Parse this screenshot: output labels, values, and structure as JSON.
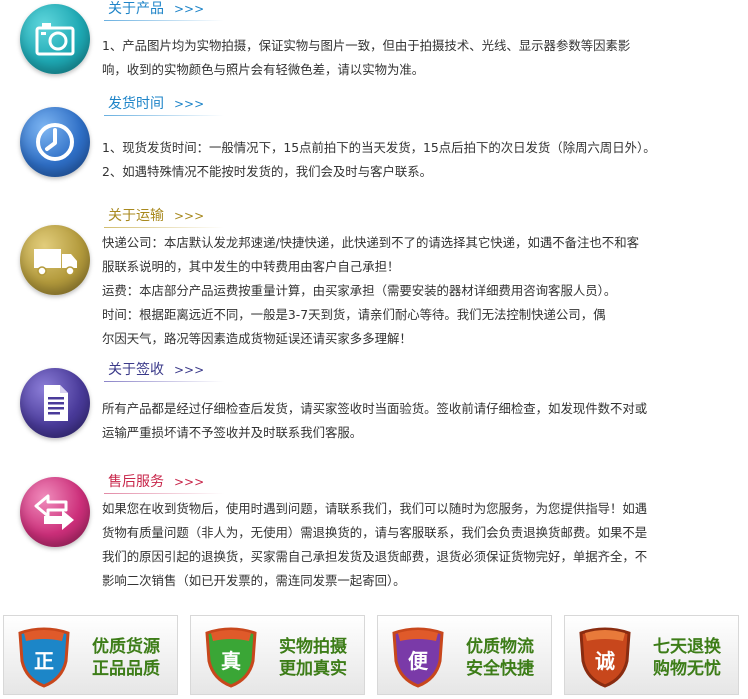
{
  "sections": [
    {
      "title": "关于产品",
      "arrows": ">>>",
      "icon": "camera-icon",
      "color": "#1eaab4",
      "lines": [
        "1、产品图片均为实物拍摄，保证实物与图片一致，但由于拍摄技术、光线、显示器参数等因素影",
        "响，收到的实物颜色与照片会有轻微色差，请以实物为准。"
      ]
    },
    {
      "title": "发货时间",
      "arrows": ">>>",
      "icon": "clock-icon",
      "color": "#2f6fc6",
      "lines": [
        "1、现货发货时间：一般情况下，15点前拍下的当天发货，15点后拍下的次日发货（除周六周日外）。",
        "2、如遇特殊情况不能按时发货的，我们会及时与客户联系。"
      ]
    },
    {
      "title": "关于运输",
      "arrows": ">>>",
      "icon": "truck-icon",
      "color": "#b39a3c",
      "lines": [
        "快递公司：本店默认发龙邦速递/快捷快递，此快递到不了的请选择其它快递，如遇不备注也不和客",
        "服联系说明的，其中发生的中转费用由客户自己承担！",
        "运费：本店部分产品运费按重量计算，由买家承担（需要安装的器材详细费用咨询客服人员）。",
        "时间：根据距离远近不同，一般是3-7天到货，请亲们耐心等待。我们无法控制快递公司，偶",
        "尔因天气，路况等因素造成货物延误还请买家多多理解！"
      ]
    },
    {
      "title": "关于签收",
      "arrows": ">>>",
      "icon": "document-icon",
      "color": "#4a3b9a",
      "lines": [
        "所有产品都是经过仔细检查后发货，请买家签收时当面验货。签收前请仔细检查，如发现件数不对或",
        "运输严重损坏请不予签收并及时联系我们客服。"
      ]
    },
    {
      "title": "售后服务",
      "arrows": ">>>",
      "icon": "exchange-arrows-icon",
      "color": "#cc2f7a",
      "lines": [
        "如果您在收到货物后，使用时遇到问题，请联系我们，我们可以随时为您服务，为您提供指导！如遇",
        "货物有质量问题（非人为，无使用）需退换货的，请与客服联系，我们会负责退换货邮费。如果不是",
        "我们的原因引起的退换货，买家需自己承担发货及退货邮费，退货必须保证货物完好，单据齐全，不",
        "影响二次销售（如已开发票的，需连同发票一起寄回）。"
      ]
    }
  ],
  "badges": [
    {
      "char": "正",
      "line1": "优质货源",
      "line2": "正品品质",
      "color": "#1c86c8"
    },
    {
      "char": "真",
      "line1": "实物拍摄",
      "line2": "更加真实",
      "color": "#3aa636"
    },
    {
      "char": "便",
      "line1": "优质物流",
      "line2": "安全快捷",
      "color": "#7a3aa8"
    },
    {
      "char": "诚",
      "line1": "七天退换",
      "line2": "购物无忧",
      "color": "#c8471c"
    }
  ]
}
